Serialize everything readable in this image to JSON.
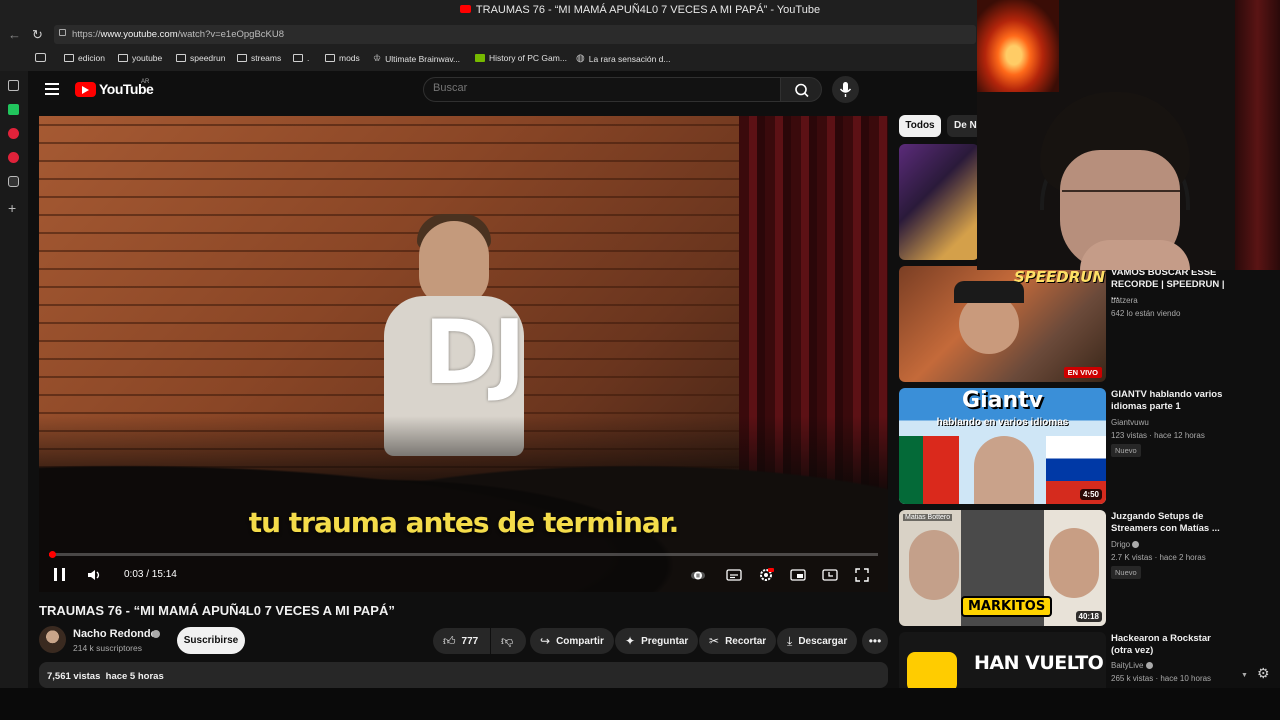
{
  "window": {
    "title": "TRAUMAS 76 - “MI MAMÁ APUÑ4L0 7 VECES A MI PAPÁ” - YouTube"
  },
  "browser": {
    "url_prefix": "https://",
    "url_host": "www.youtube.com",
    "url_path": "/watch?v=e1eOpgBcKU8",
    "bookmarks": [
      {
        "label": "edicion",
        "icon": "folder-icon"
      },
      {
        "label": "youtube",
        "icon": "folder-icon"
      },
      {
        "label": "speedrun",
        "icon": "folder-icon"
      },
      {
        "label": "streams",
        "icon": "folder-icon"
      },
      {
        "label": ".",
        "icon": "folder-icon"
      },
      {
        "label": "mods",
        "icon": "folder-icon"
      },
      {
        "label": "Ultimate Brainwav...",
        "icon": "crown-icon"
      },
      {
        "label": "History of PC Gam...",
        "icon": "nvidia-icon"
      },
      {
        "label": "La rara sensación d...",
        "icon": "globe-icon"
      }
    ]
  },
  "youtube": {
    "logo_text": "YouTube",
    "region": "AR",
    "search_placeholder": "Buscar"
  },
  "player": {
    "overlay_text": "DJ",
    "caption": "tu trauma antes de terminar.",
    "current_time": "0:03",
    "duration": "15:14",
    "time_display": "0:03 / 15:14",
    "progress_fraction": 0.0033
  },
  "video": {
    "title": "TRAUMAS 76 - “MI MAMÁ APUÑ4L0 7 VECES A MI PAPÁ”",
    "channel": "Nacho Redondo",
    "subscribers": "214 k suscriptores",
    "subscribe_label": "Suscribirse",
    "likes": "777",
    "share_label": "Compartir",
    "ask_label": "Preguntar",
    "clip_label": "Recortar",
    "download_label": "Descargar",
    "views": "7,561 vistas",
    "age": "hace 5 horas"
  },
  "chips": [
    "Todos",
    "De Na"
  ],
  "recommendations": [
    {
      "title": "VAMOS BUSCAR ESSE RECORDE | SPEEDRUN | ...",
      "channel": "batzera",
      "meta": "642 lo están viendo",
      "live_label": "EN VIVO",
      "thumb_text": "SPEEDRUN"
    },
    {
      "title": "GIANTV hablando varios idiomas parte 1",
      "channel": "Giantvuwu",
      "meta": "123 vistas · hace 12 horas",
      "badge": "Nuevo",
      "duration": "4:50",
      "thumb_title": "Giantv",
      "thumb_sub": "hablando en varios idiomas"
    },
    {
      "title": "Juzgando Setups de Streamers con Matías ...",
      "channel": "Drigo",
      "meta": "2.7 K vistas · hace 2 horas",
      "badge": "Nuevo",
      "duration": "40:18",
      "thumb_text": "MARKITOS",
      "thumb_tag": "Matias Bottero"
    },
    {
      "title": "Hackearon a Rockstar (otra vez)",
      "channel": "BaityLive",
      "meta": "265 k vistas · hace 10 horas",
      "thumb_text": "HAN VUELTO"
    }
  ],
  "colors": {
    "accent": "#ff0000",
    "background": "#0f0f0f",
    "caption": "#f4dc4a"
  }
}
